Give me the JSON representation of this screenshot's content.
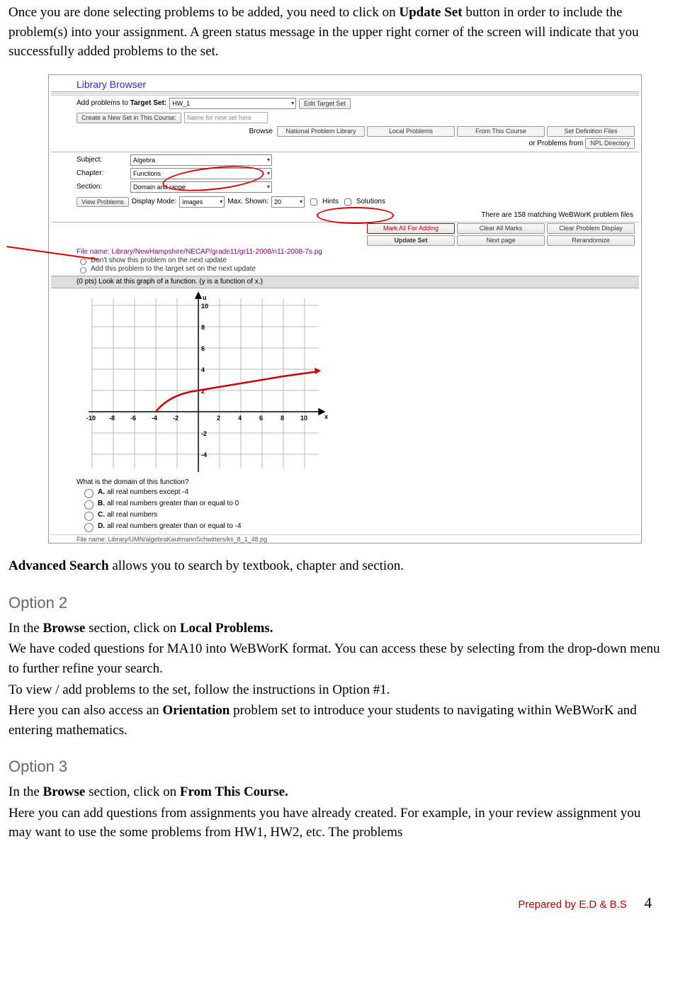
{
  "intro": {
    "p1a": "Once you are done selecting problems to be added, you need to click on ",
    "p1b": "Update Set",
    "p1c": " button in order to include the problem(s) into your assignment. A green status message in the upper right corner of the screen will indicate that you successfully added problems to the set."
  },
  "shot": {
    "libBrowser": "Library Browser",
    "addProblemsLabel": "Add problems to ",
    "targetSetLabel": "Target Set:",
    "targetSetValue": "HW_1",
    "editTargetSet": "Edit Target Set",
    "createNewSet": "Create a New Set in This Course:",
    "newSetPlaceholder": "Name for new set here",
    "browseLabel": "Browse",
    "tabs": [
      "National Problem Library",
      "Local Problems",
      "From This Course",
      "Set Definition Files"
    ],
    "orProblemsFrom": "or Problems from",
    "nplDirectory": "NPL Directory",
    "subjectLabel": "Subject:",
    "subjectValue": "Algebra",
    "chapterLabel": "Chapter:",
    "chapterValue": "Functions",
    "sectionLabel": "Section:",
    "sectionValue": "Domain and range",
    "viewProblems": "View Problems",
    "displayMode": "Display Mode:",
    "displayModeValue": "images",
    "maxShown": "Max. Shown:",
    "maxShownValue": "20",
    "hints": "Hints",
    "solutions": "Solutions",
    "matchingText": "There are 158 matching WeBWorK problem files",
    "markAll": "Mark All For Adding",
    "clearMarks": "Clear All Marks",
    "clearDisplay": "Clear Problem Display",
    "updateSet": "Update Set",
    "nextPage": "Next page",
    "rerandomize": "Rerandomize",
    "fileName": "File name: Library/NewHampshire/NECAP/grade11/gr11-2008/n11-2008-7s.pg",
    "dontShow": "Don't show this problem on the next update",
    "addThis": "Add this problem to the target set on the next update",
    "probHead": "(0 pts) Look at this graph of a function. (y is a function of x.)",
    "axisLabelU": "u",
    "axisLabelX": "x",
    "question": "What is the domain of this function?",
    "answers": [
      {
        "let": "A.",
        "text": "all real numbers except -4"
      },
      {
        "let": "B.",
        "text": "all real numbers greater than or equal to 0"
      },
      {
        "let": "C.",
        "text": "all real numbers"
      },
      {
        "let": "D.",
        "text": "all real numbers greater than or equal to -4"
      }
    ],
    "cutFile": "File name: Library/UMN/algebraKaufmannSchwitters/ks_8_1_48.pg"
  },
  "advSearch": {
    "lead": "Advanced Search",
    "rest": " allows you to search by textbook, chapter and section."
  },
  "option2": {
    "heading": "Option 2",
    "l1a": "In the ",
    "l1b": "Browse",
    "l1c": " section, click on ",
    "l1d": "Local Problems.",
    "l2": "We have coded questions for MA10 into WeBWorK format. You can access these by selecting from the drop-down menu to further refine your search.",
    "l3": "To view / add problems to the set, follow the instructions in Option #1.",
    "l4a": "Here you can also access an ",
    "l4b": "Orientation",
    "l4c": " problem set to introduce your students to navigating within WeBWorK and entering mathematics."
  },
  "option3": {
    "heading": "Option 3",
    "l1a": "In the ",
    "l1b": "Browse",
    "l1c": " section, click on ",
    "l1d": "From This Course.",
    "l2": "Here you can add questions from assignments you have already created. For example, in your review assignment you may want to use the some problems from HW1, HW2, etc. The problems"
  },
  "footer": {
    "prep": "Prepared by E.D & B.S",
    "page": "4"
  },
  "chart_data": {
    "type": "line",
    "title": "",
    "xlabel": "x",
    "ylabel": "u",
    "xlim": [
      -11,
      11
    ],
    "ylim": [
      -5,
      11
    ],
    "xticks": [
      -10,
      -8,
      -6,
      -4,
      -2,
      2,
      4,
      6,
      8,
      10
    ],
    "yticks": [
      -4,
      -2,
      2,
      4,
      6,
      8,
      10
    ],
    "series": [
      {
        "name": "function",
        "color": "#cc0000",
        "points": [
          {
            "x": -4,
            "y": 0
          },
          {
            "x": -2,
            "y": 1.4
          },
          {
            "x": 0,
            "y": 2
          },
          {
            "x": 2,
            "y": 2.4
          },
          {
            "x": 4,
            "y": 2.8
          },
          {
            "x": 6,
            "y": 3.2
          },
          {
            "x": 8,
            "y": 3.5
          },
          {
            "x": 10,
            "y": 3.7
          },
          {
            "x": 11,
            "y": 3.9
          }
        ]
      }
    ]
  }
}
